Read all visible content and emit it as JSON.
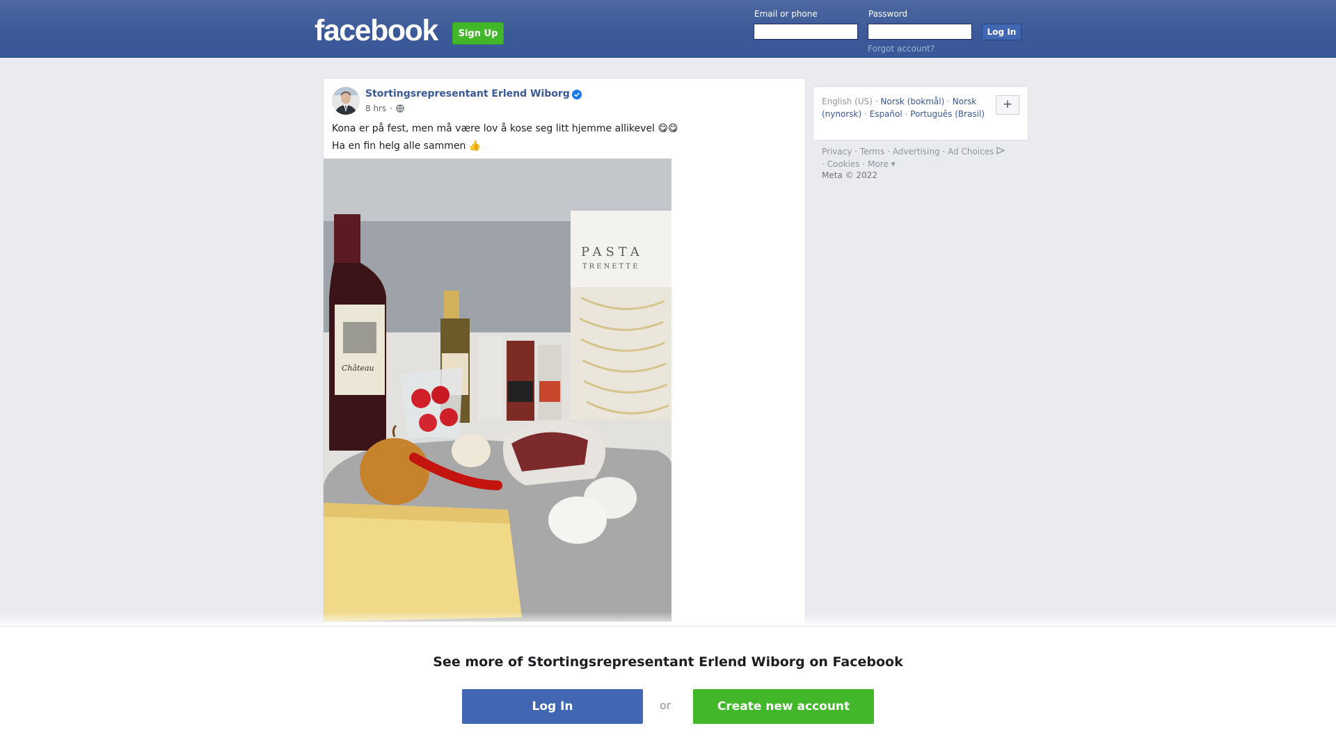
{
  "header": {
    "logo_text": "facebook",
    "signup_label": "Sign Up",
    "email_label": "Email or phone",
    "password_label": "Password",
    "login_label": "Log In",
    "forgot_label": "Forgot account?"
  },
  "post": {
    "author": "Stortingsrepresentant Erlend Wiborg",
    "verified": true,
    "time": "8 hrs",
    "separator": "·",
    "audience_icon": "globe-icon",
    "text_lines": [
      "Kona er på fest, men må være lov å kose seg litt hjemme allikevel 😋😋",
      "Ha en fin helg alle sammen 👍"
    ],
    "photo_subject": "wine bottle, olive oil, spices, pasta trenette, tomatoes, onion, chili, garlic, pancetta, eggs, parmesan",
    "reactions": "",
    "comments_shares": ""
  },
  "sidebar": {
    "languages": [
      "English (US)",
      "Norsk (bokmål)",
      "Norsk (nynorsk)",
      "Español",
      "Português (Brasil)"
    ],
    "add_language_label": "+",
    "footer_links": [
      "Privacy",
      "Terms",
      "Advertising",
      "Ad Choices",
      "Cookies",
      "More"
    ],
    "copyright": "Meta © 2022"
  },
  "bottom": {
    "title": "See more of Stortingsrepresentant Erlend Wiborg on Facebook",
    "login_label": "Log In",
    "or_label": "or",
    "create_label": "Create new account"
  },
  "colors": {
    "brand": "#3b5998",
    "button_blue": "#4267b2",
    "button_green": "#42b72a",
    "link": "#385898"
  }
}
